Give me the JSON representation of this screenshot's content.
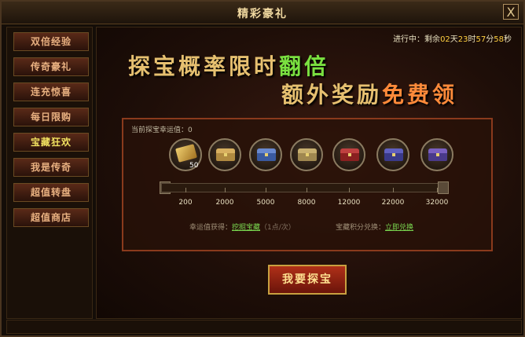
{
  "window": {
    "title": "精彩豪礼",
    "close_label": "X"
  },
  "sidebar": {
    "items": [
      {
        "label": "双倍经验",
        "active": false
      },
      {
        "label": "传奇豪礼",
        "active": false
      },
      {
        "label": "连充惊喜",
        "active": false
      },
      {
        "label": "每日限购",
        "active": false
      },
      {
        "label": "宝藏狂欢",
        "active": true
      },
      {
        "label": "我是传奇",
        "active": false
      },
      {
        "label": "超值转盘",
        "active": false
      },
      {
        "label": "超值商店",
        "active": false
      }
    ]
  },
  "status": {
    "prefix": "进行中：剩余",
    "days": "02",
    "day_unit": "天",
    "hours": "23",
    "hour_unit": "时",
    "minutes": "57",
    "minute_unit": "分",
    "seconds": "58",
    "second_unit": "秒"
  },
  "banner": {
    "line1_main": "探宝概率限时",
    "line1_highlight": "翻倍",
    "line2_main": "额外奖励",
    "line2_highlight": "免费领"
  },
  "panel": {
    "luck_label": "当前探宝幸运值：0",
    "luck_value": 0,
    "scroll_count": "50",
    "chests": [
      {
        "icon": "scroll-icon"
      },
      {
        "icon": "chest-gold-icon"
      },
      {
        "icon": "chest-blue-icon"
      },
      {
        "icon": "chest-gold-icon"
      },
      {
        "icon": "chest-red-icon"
      },
      {
        "icon": "chest-purple-icon"
      },
      {
        "icon": "chest-purple-icon"
      }
    ],
    "thresholds": [
      "200",
      "2000",
      "5000",
      "8000",
      "12000",
      "22000",
      "32000"
    ],
    "progress": 0,
    "luck_gain_label": "幸运值获得：",
    "luck_gain_link": "挖掘宝藏",
    "luck_gain_note": "（1点/次）",
    "exchange_label": "宝藏积分兑换：",
    "exchange_link": "立即兑换"
  },
  "action": {
    "label": "我要探宝"
  },
  "colors": {
    "accent_green": "#7ae040",
    "accent_orange": "#ff8a3a",
    "gold": "#e6c070"
  }
}
